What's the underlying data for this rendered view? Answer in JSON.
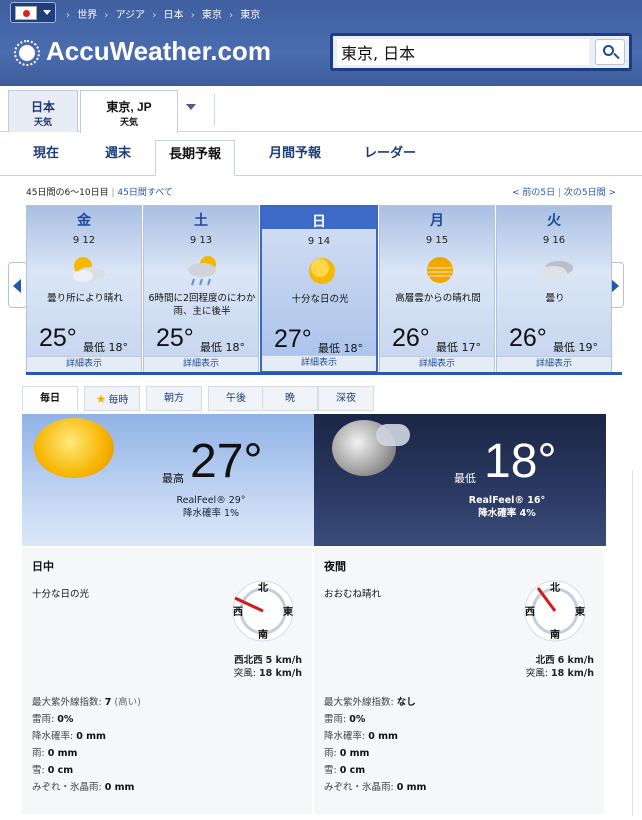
{
  "header": {
    "breadcrumbs": [
      "世界",
      "アジア",
      "日本",
      "東京",
      "東京"
    ],
    "logo_text": "AccuWeather.com",
    "search_value": "東京, 日本",
    "colors": {
      "header_bg": "#4a6cb0",
      "search_border": "#1c3c86"
    }
  },
  "location_tabs": [
    {
      "line1": "日本",
      "line2": "天気"
    },
    {
      "line1": "東京, JP",
      "line2": "天気"
    }
  ],
  "sub_tabs": [
    "現在",
    "週末",
    "長期予報",
    "月間予報",
    "レーダー"
  ],
  "nav": {
    "range_text": "45日間の6〜10日目",
    "all_link": "45日間すべて",
    "prev": "< 前の5日",
    "next": "次の5日間 >"
  },
  "days": [
    {
      "dow": "金",
      "date": "9 12",
      "condition": "曇り所により晴れ",
      "high": "25°",
      "low": "最低 18°",
      "detail": "詳細表示",
      "icon": "partly-sunny-icon"
    },
    {
      "dow": "土",
      "date": "9 13",
      "condition": "6時間に2回程度のにわか雨、主に後半",
      "high": "25°",
      "low": "最低 18°",
      "detail": "詳細表示",
      "icon": "sun-showers-icon"
    },
    {
      "dow": "日",
      "date": "9 14",
      "condition": "十分な日の光",
      "high": "27°",
      "low": "最低 18°",
      "detail": "詳細表示",
      "icon": "sunny-icon"
    },
    {
      "dow": "月",
      "date": "9 15",
      "condition": "高層雲からの晴れ間",
      "high": "26°",
      "low": "最低 17°",
      "detail": "詳細表示",
      "icon": "hazy-sun-icon"
    },
    {
      "dow": "火",
      "date": "9 16",
      "condition": "曇り",
      "high": "26°",
      "low": "最低 19°",
      "detail": "詳細表示",
      "icon": "cloudy-icon"
    }
  ],
  "period_tabs": [
    "毎日",
    "毎時",
    "朝方",
    "午後",
    "晩",
    "深夜"
  ],
  "day_panel": {
    "label": "最高",
    "temp": "27°",
    "realfeel": "RealFeel® 29°",
    "precip": "降水確率 1%"
  },
  "night_panel": {
    "label": "最低",
    "temp": "18°",
    "realfeel": "RealFeel® 16°",
    "precip": "降水確率 4%"
  },
  "compass_labels": {
    "n": "北",
    "s": "南",
    "e": "東",
    "w": "西"
  },
  "day_detail": {
    "heading": "日中",
    "phrase": "十分な日の光",
    "wind_dir": "西北西",
    "wind_speed": "5 km/h",
    "gust_label": "突風:",
    "gust": "18 km/h",
    "uv_label": "最大紫外線指数:",
    "uv_value": "7",
    "uv_note": "(高い)",
    "thunder_label": "雷雨:",
    "thunder": "0%",
    "precip_label": "降水確率:",
    "precip": "0 mm",
    "rain_label": "雨:",
    "rain": "0 mm",
    "snow_label": "雪:",
    "snow": "0 cm",
    "ice_label": "みぞれ・氷晶雨:",
    "ice": "0 mm"
  },
  "night_detail": {
    "heading": "夜間",
    "phrase": "おおむね晴れ",
    "wind_dir": "北西",
    "wind_speed": "6 km/h",
    "gust_label": "突風:",
    "gust": "18 km/h",
    "uv_label": "最大紫外線指数:",
    "uv_value": "なし",
    "thunder_label": "雷雨:",
    "thunder": "0%",
    "precip_label": "降水確率:",
    "precip": "0 mm",
    "rain_label": "雨:",
    "rain": "0 mm",
    "snow_label": "雪:",
    "snow": "0 cm",
    "ice_label": "みぞれ・氷晶雨:",
    "ice": "0 mm"
  }
}
